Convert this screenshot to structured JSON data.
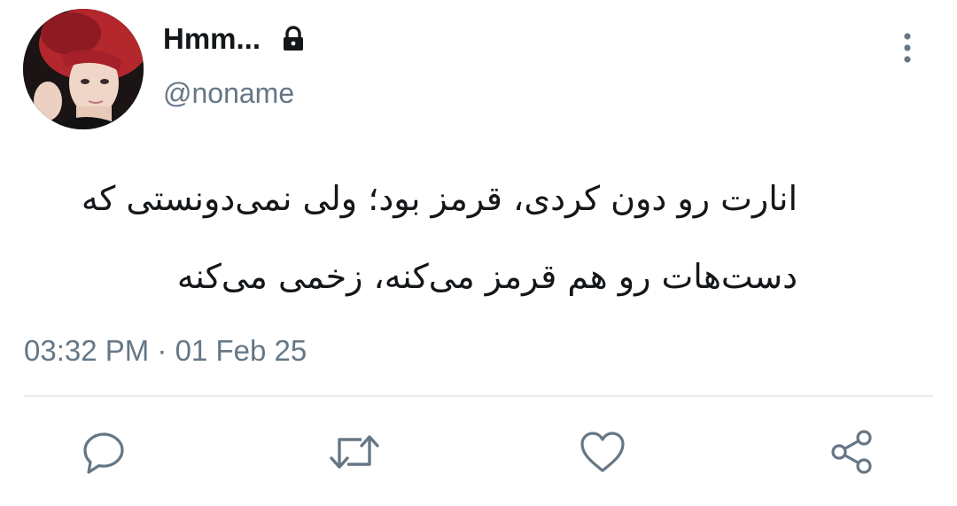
{
  "tweet": {
    "display_name": "Hmm...",
    "handle": "@noname",
    "text_lines": [
      "انارت رو دون کردی، قرمز بود؛ ولی نمی‌دونستی که",
      "دست‌هات رو هم قرمز می‌کنه، زخمی می‌کنه"
    ],
    "timestamp": "03:32 PM · 01 Feb 25"
  },
  "icons": {
    "lock": "lock-icon",
    "more": "more-vertical-icon",
    "reply": "reply-icon",
    "retweet": "retweet-icon",
    "like": "heart-icon",
    "share": "share-icon"
  },
  "colors": {
    "text_primary": "#14171a",
    "text_secondary": "#657786",
    "icon_gray": "#657786",
    "divider": "#e6ecf0"
  }
}
